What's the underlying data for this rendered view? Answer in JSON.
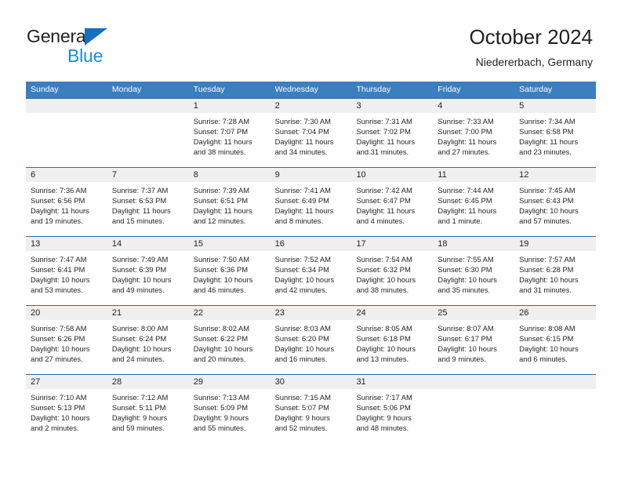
{
  "brand": {
    "name_top": "General",
    "name_bottom": "Blue",
    "accent_color": "#1471bd",
    "accent_color_light": "#1b8cd8"
  },
  "header": {
    "title": "October 2024",
    "location": "Niedererbach, Germany",
    "header_bg": "#3d7ebf",
    "header_text_color": "#ffffff"
  },
  "weekday_headers": [
    "Sunday",
    "Monday",
    "Tuesday",
    "Wednesday",
    "Thursday",
    "Friday",
    "Saturday"
  ],
  "weeks": [
    [
      {
        "day": "",
        "sunrise": "",
        "sunset": "",
        "daylight_1": "",
        "daylight_2": ""
      },
      {
        "day": "",
        "sunrise": "",
        "sunset": "",
        "daylight_1": "",
        "daylight_2": ""
      },
      {
        "day": "1",
        "sunrise": "Sunrise: 7:28 AM",
        "sunset": "Sunset: 7:07 PM",
        "daylight_1": "Daylight: 11 hours",
        "daylight_2": "and 38 minutes."
      },
      {
        "day": "2",
        "sunrise": "Sunrise: 7:30 AM",
        "sunset": "Sunset: 7:04 PM",
        "daylight_1": "Daylight: 11 hours",
        "daylight_2": "and 34 minutes."
      },
      {
        "day": "3",
        "sunrise": "Sunrise: 7:31 AM",
        "sunset": "Sunset: 7:02 PM",
        "daylight_1": "Daylight: 11 hours",
        "daylight_2": "and 31 minutes."
      },
      {
        "day": "4",
        "sunrise": "Sunrise: 7:33 AM",
        "sunset": "Sunset: 7:00 PM",
        "daylight_1": "Daylight: 11 hours",
        "daylight_2": "and 27 minutes."
      },
      {
        "day": "5",
        "sunrise": "Sunrise: 7:34 AM",
        "sunset": "Sunset: 6:58 PM",
        "daylight_1": "Daylight: 11 hours",
        "daylight_2": "and 23 minutes."
      }
    ],
    [
      {
        "day": "6",
        "sunrise": "Sunrise: 7:36 AM",
        "sunset": "Sunset: 6:56 PM",
        "daylight_1": "Daylight: 11 hours",
        "daylight_2": "and 19 minutes."
      },
      {
        "day": "7",
        "sunrise": "Sunrise: 7:37 AM",
        "sunset": "Sunset: 6:53 PM",
        "daylight_1": "Daylight: 11 hours",
        "daylight_2": "and 15 minutes."
      },
      {
        "day": "8",
        "sunrise": "Sunrise: 7:39 AM",
        "sunset": "Sunset: 6:51 PM",
        "daylight_1": "Daylight: 11 hours",
        "daylight_2": "and 12 minutes."
      },
      {
        "day": "9",
        "sunrise": "Sunrise: 7:41 AM",
        "sunset": "Sunset: 6:49 PM",
        "daylight_1": "Daylight: 11 hours",
        "daylight_2": "and 8 minutes."
      },
      {
        "day": "10",
        "sunrise": "Sunrise: 7:42 AM",
        "sunset": "Sunset: 6:47 PM",
        "daylight_1": "Daylight: 11 hours",
        "daylight_2": "and 4 minutes."
      },
      {
        "day": "11",
        "sunrise": "Sunrise: 7:44 AM",
        "sunset": "Sunset: 6:45 PM",
        "daylight_1": "Daylight: 11 hours",
        "daylight_2": "and 1 minute."
      },
      {
        "day": "12",
        "sunrise": "Sunrise: 7:45 AM",
        "sunset": "Sunset: 6:43 PM",
        "daylight_1": "Daylight: 10 hours",
        "daylight_2": "and 57 minutes."
      }
    ],
    [
      {
        "day": "13",
        "sunrise": "Sunrise: 7:47 AM",
        "sunset": "Sunset: 6:41 PM",
        "daylight_1": "Daylight: 10 hours",
        "daylight_2": "and 53 minutes."
      },
      {
        "day": "14",
        "sunrise": "Sunrise: 7:49 AM",
        "sunset": "Sunset: 6:39 PM",
        "daylight_1": "Daylight: 10 hours",
        "daylight_2": "and 49 minutes."
      },
      {
        "day": "15",
        "sunrise": "Sunrise: 7:50 AM",
        "sunset": "Sunset: 6:36 PM",
        "daylight_1": "Daylight: 10 hours",
        "daylight_2": "and 46 minutes."
      },
      {
        "day": "16",
        "sunrise": "Sunrise: 7:52 AM",
        "sunset": "Sunset: 6:34 PM",
        "daylight_1": "Daylight: 10 hours",
        "daylight_2": "and 42 minutes."
      },
      {
        "day": "17",
        "sunrise": "Sunrise: 7:54 AM",
        "sunset": "Sunset: 6:32 PM",
        "daylight_1": "Daylight: 10 hours",
        "daylight_2": "and 38 minutes."
      },
      {
        "day": "18",
        "sunrise": "Sunrise: 7:55 AM",
        "sunset": "Sunset: 6:30 PM",
        "daylight_1": "Daylight: 10 hours",
        "daylight_2": "and 35 minutes."
      },
      {
        "day": "19",
        "sunrise": "Sunrise: 7:57 AM",
        "sunset": "Sunset: 6:28 PM",
        "daylight_1": "Daylight: 10 hours",
        "daylight_2": "and 31 minutes."
      }
    ],
    [
      {
        "day": "20",
        "sunrise": "Sunrise: 7:58 AM",
        "sunset": "Sunset: 6:26 PM",
        "daylight_1": "Daylight: 10 hours",
        "daylight_2": "and 27 minutes."
      },
      {
        "day": "21",
        "sunrise": "Sunrise: 8:00 AM",
        "sunset": "Sunset: 6:24 PM",
        "daylight_1": "Daylight: 10 hours",
        "daylight_2": "and 24 minutes."
      },
      {
        "day": "22",
        "sunrise": "Sunrise: 8:02 AM",
        "sunset": "Sunset: 6:22 PM",
        "daylight_1": "Daylight: 10 hours",
        "daylight_2": "and 20 minutes."
      },
      {
        "day": "23",
        "sunrise": "Sunrise: 8:03 AM",
        "sunset": "Sunset: 6:20 PM",
        "daylight_1": "Daylight: 10 hours",
        "daylight_2": "and 16 minutes."
      },
      {
        "day": "24",
        "sunrise": "Sunrise: 8:05 AM",
        "sunset": "Sunset: 6:18 PM",
        "daylight_1": "Daylight: 10 hours",
        "daylight_2": "and 13 minutes."
      },
      {
        "day": "25",
        "sunrise": "Sunrise: 8:07 AM",
        "sunset": "Sunset: 6:17 PM",
        "daylight_1": "Daylight: 10 hours",
        "daylight_2": "and 9 minutes."
      },
      {
        "day": "26",
        "sunrise": "Sunrise: 8:08 AM",
        "sunset": "Sunset: 6:15 PM",
        "daylight_1": "Daylight: 10 hours",
        "daylight_2": "and 6 minutes."
      }
    ],
    [
      {
        "day": "27",
        "sunrise": "Sunrise: 7:10 AM",
        "sunset": "Sunset: 5:13 PM",
        "daylight_1": "Daylight: 10 hours",
        "daylight_2": "and 2 minutes."
      },
      {
        "day": "28",
        "sunrise": "Sunrise: 7:12 AM",
        "sunset": "Sunset: 5:11 PM",
        "daylight_1": "Daylight: 9 hours",
        "daylight_2": "and 59 minutes."
      },
      {
        "day": "29",
        "sunrise": "Sunrise: 7:13 AM",
        "sunset": "Sunset: 5:09 PM",
        "daylight_1": "Daylight: 9 hours",
        "daylight_2": "and 55 minutes."
      },
      {
        "day": "30",
        "sunrise": "Sunrise: 7:15 AM",
        "sunset": "Sunset: 5:07 PM",
        "daylight_1": "Daylight: 9 hours",
        "daylight_2": "and 52 minutes."
      },
      {
        "day": "31",
        "sunrise": "Sunrise: 7:17 AM",
        "sunset": "Sunset: 5:06 PM",
        "daylight_1": "Daylight: 9 hours",
        "daylight_2": "and 48 minutes."
      },
      {
        "day": "",
        "sunrise": "",
        "sunset": "",
        "daylight_1": "",
        "daylight_2": ""
      },
      {
        "day": "",
        "sunrise": "",
        "sunset": "",
        "daylight_1": "",
        "daylight_2": ""
      }
    ]
  ]
}
